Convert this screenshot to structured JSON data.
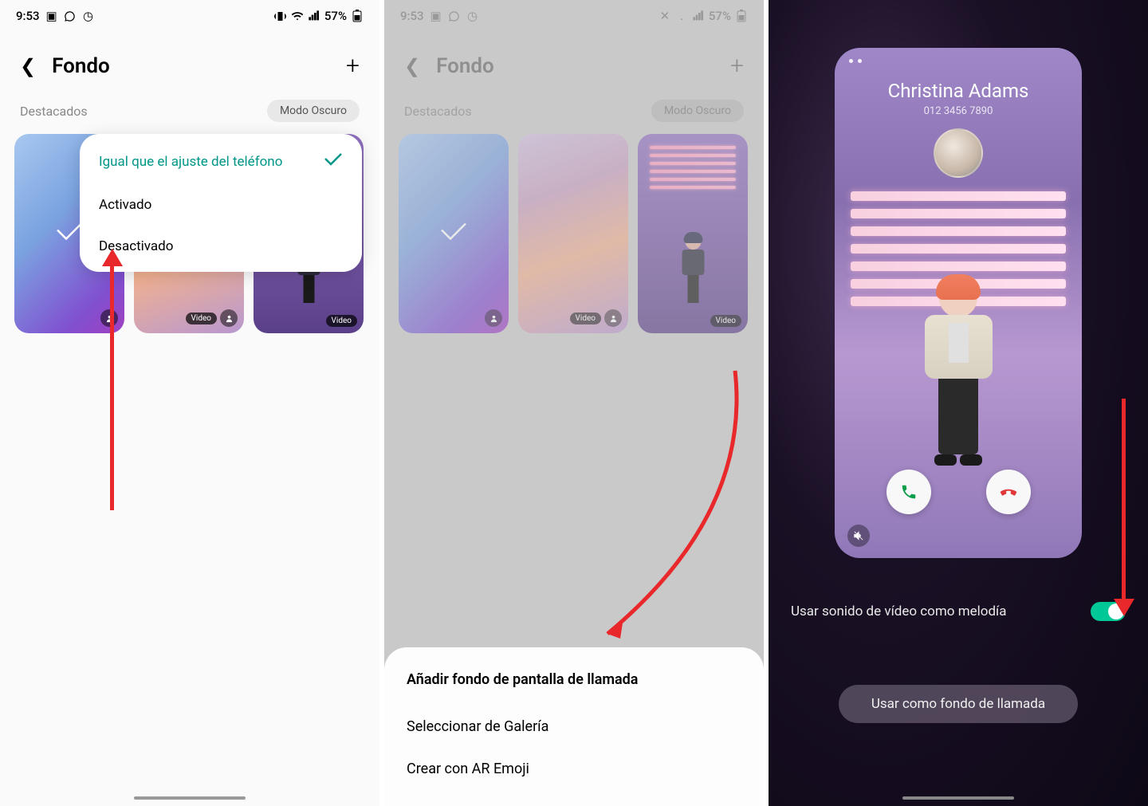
{
  "status": {
    "time": "9:53",
    "battery": "57%"
  },
  "header": {
    "title": "Fondo"
  },
  "dest": {
    "label": "Destacados",
    "dark_mode": "Modo Oscuro"
  },
  "badges": {
    "video": "Video"
  },
  "popup": {
    "item_same": "Igual que el ajuste del teléfono",
    "item_on": "Activado",
    "item_off": "Desactivado"
  },
  "sheet": {
    "title": "Añadir fondo de pantalla de llamada",
    "gallery": "Seleccionar de Galería",
    "ar": "Crear con AR Emoji"
  },
  "preview": {
    "name": "Christina Adams",
    "number": "012 3456 7890"
  },
  "toggle_label": "Usar sonido de vídeo como melodía",
  "cta": "Usar como fondo de llamada"
}
